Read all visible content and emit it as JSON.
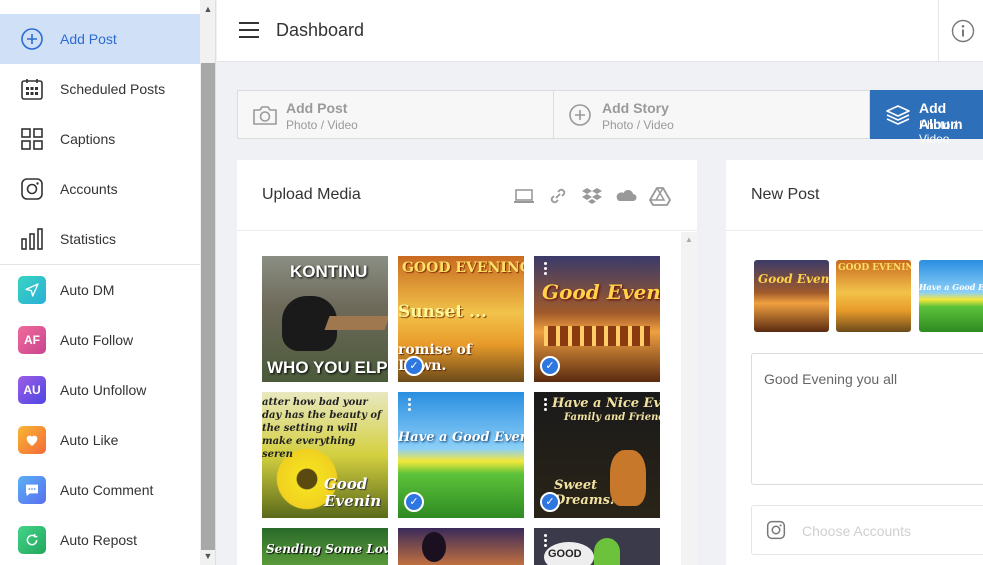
{
  "sidebar": {
    "items": [
      {
        "label": "Add Post",
        "icon": "plus-circle-icon"
      },
      {
        "label": "Scheduled Posts",
        "icon": "calendar-icon"
      },
      {
        "label": "Captions",
        "icon": "grid-icon"
      },
      {
        "label": "Accounts",
        "icon": "instagram-icon"
      },
      {
        "label": "Statistics",
        "icon": "bar-chart-icon"
      },
      {
        "label": "Auto DM",
        "icon": "send-icon",
        "color": "#2ec4c9"
      },
      {
        "label": "Auto Follow",
        "icon": "af-tile",
        "tile_text": "AF",
        "color": "#e0508d"
      },
      {
        "label": "Auto Unfollow",
        "icon": "au-tile",
        "tile_text": "AU",
        "color": "#7250d8"
      },
      {
        "label": "Auto Like",
        "icon": "heart-icon",
        "color": "#f5893a"
      },
      {
        "label": "Auto Comment",
        "icon": "comment-icon",
        "color": "#5a8ef0"
      },
      {
        "label": "Auto Repost",
        "icon": "repost-icon",
        "color": "#2fbf71"
      }
    ]
  },
  "header": {
    "title": "Dashboard"
  },
  "type_tabs": [
    {
      "title": "Add Post",
      "subtitle": "Photo / Video",
      "icon": "camera-icon"
    },
    {
      "title": "Add Story",
      "subtitle": "Photo / Video",
      "icon": "plus-circle-icon"
    },
    {
      "title": "Add Album",
      "subtitle": "Photo / Video",
      "icon": "layers-icon"
    }
  ],
  "upload": {
    "title": "Upload Media",
    "sources": [
      "laptop-icon",
      "link-icon",
      "dropbox-icon",
      "onedrive-icon",
      "google-drive-icon"
    ],
    "media": [
      {
        "caption_top": "KONTINU",
        "caption_bottom": "WHO YOU ELP?",
        "checked": false
      },
      {
        "caption_top": "GOOD EVENING",
        "caption_mid": "Sunset ...",
        "caption_bottom": "romise of Dawn.",
        "checked": true
      },
      {
        "caption_top": "Good Evening",
        "checked": true
      },
      {
        "caption_top": "atter how bad your day has the beauty of the setting n will make everything seren",
        "caption_bottom": "Good Evenin",
        "checked": false
      },
      {
        "caption_top": "Have a Good Evenin",
        "checked": true
      },
      {
        "caption_top": "Have a Nice Evening",
        "caption_mid": "Family and Friends",
        "caption_bottom": "Sweet Dreams!",
        "checked": true
      },
      {
        "caption_top": "Sending Some Love",
        "checked": false
      },
      {
        "caption_top": "",
        "checked": false
      },
      {
        "caption_top": "GOOD",
        "checked": false
      }
    ]
  },
  "new_post": {
    "title": "New Post",
    "caption": "Good Evening you all",
    "accounts_placeholder": "Choose Accounts",
    "selected_media": [
      "Good Evening",
      "GOOD EVENING",
      "Have a Good Even"
    ]
  }
}
